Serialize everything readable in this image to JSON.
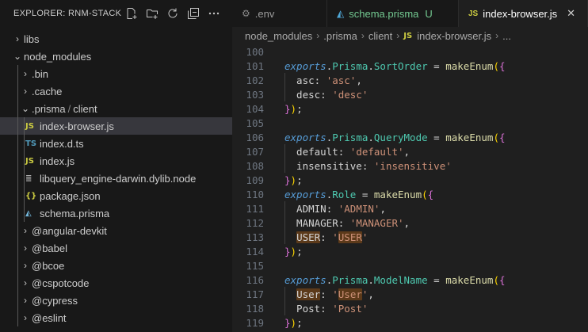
{
  "explorer": {
    "title": "EXPLORER: RNM-STACK",
    "tree": [
      {
        "label": "libs",
        "chevron": "›",
        "icon": "",
        "icon_color": "",
        "label_color": "#cccccc"
      },
      {
        "label": "node_modules",
        "chevron": "⌄",
        "icon": "",
        "icon_color": "",
        "label_color": "#cccccc"
      },
      {
        "label": ".bin",
        "chevron": "›",
        "icon": "",
        "icon_color": "",
        "label_color": "#cccccc"
      },
      {
        "label": ".cache",
        "chevron": "›",
        "icon": "",
        "icon_color": "",
        "label_color": "#cccccc"
      },
      {
        "label": ".prisma",
        "label2": "client",
        "chevron": "⌄",
        "icon": "",
        "icon_color": "",
        "label_color": "#cccccc"
      },
      {
        "label": "index-browser.js",
        "chevron": "",
        "icon": "JS",
        "icon_color": "#cbcb41",
        "label_color": "#cccccc"
      },
      {
        "label": "index.d.ts",
        "chevron": "",
        "icon": "TS",
        "icon_color": "#519aba",
        "label_color": "#cccccc"
      },
      {
        "label": "index.js",
        "chevron": "",
        "icon": "JS",
        "icon_color": "#cbcb41",
        "label_color": "#cccccc"
      },
      {
        "label": "libquery_engine-darwin.dylib.node",
        "chevron": "",
        "icon": "≣",
        "icon_color": "#aaaaaa",
        "label_color": "#cccccc"
      },
      {
        "label": "package.json",
        "chevron": "",
        "icon": "{}",
        "icon_color": "#cbcb41",
        "label_color": "#cccccc"
      },
      {
        "label": "schema.prisma",
        "chevron": "",
        "icon": "◭",
        "icon_color": "#75bbe0",
        "label_color": "#cccccc"
      },
      {
        "label": "@angular-devkit",
        "chevron": "›",
        "icon": "",
        "icon_color": "",
        "label_color": "#cccccc"
      },
      {
        "label": "@babel",
        "chevron": "›",
        "icon": "",
        "icon_color": "",
        "label_color": "#cccccc"
      },
      {
        "label": "@bcoe",
        "chevron": "›",
        "icon": "",
        "icon_color": "",
        "label_color": "#cccccc"
      },
      {
        "label": "@cspotcode",
        "chevron": "›",
        "icon": "",
        "icon_color": "",
        "label_color": "#cccccc"
      },
      {
        "label": "@cypress",
        "chevron": "›",
        "icon": "",
        "icon_color": "",
        "label_color": "#cccccc"
      },
      {
        "label": "@eslint",
        "chevron": "›",
        "icon": "",
        "icon_color": "",
        "label_color": "#cccccc"
      }
    ]
  },
  "tabs": [
    {
      "label": ".env",
      "icon": "gear-icon",
      "badge": "",
      "active": false,
      "color": "#cccccc"
    },
    {
      "label": "schema.prisma",
      "icon": "prisma-icon",
      "badge": "U",
      "active": false,
      "color": "#73c991"
    },
    {
      "label": "index-browser.js",
      "icon": "js-icon",
      "badge": "",
      "active": true,
      "color": "#ffffff"
    }
  ],
  "tab_close": "✕",
  "breadcrumb": [
    "node_modules",
    ".prisma",
    "client",
    "index-browser.js",
    "..."
  ],
  "editor": {
    "lines": [
      {
        "n": "100",
        "tokens": []
      },
      {
        "n": "101",
        "tokens": [
          [
            "exports",
            "kw-exports"
          ],
          [
            ".",
            "c-white"
          ],
          [
            "Prisma",
            "c-ident"
          ],
          [
            ".",
            "c-white"
          ],
          [
            "SortOrder",
            "c-ident"
          ],
          [
            " = ",
            "c-white"
          ],
          [
            "makeEnum",
            "c-fn"
          ],
          [
            "(",
            "c-brace"
          ],
          [
            "{",
            "c-paren"
          ]
        ]
      },
      {
        "n": "102",
        "indent": true,
        "tokens": [
          [
            "  asc",
            "c-white"
          ],
          [
            ": ",
            "c-white"
          ],
          [
            "'asc'",
            "c-str"
          ],
          [
            ",",
            "c-white"
          ]
        ]
      },
      {
        "n": "103",
        "indent": true,
        "tokens": [
          [
            "  desc",
            "c-white"
          ],
          [
            ": ",
            "c-white"
          ],
          [
            "'desc'",
            "c-str"
          ]
        ]
      },
      {
        "n": "104",
        "tokens": [
          [
            "}",
            "c-paren"
          ],
          [
            ")",
            "c-brace"
          ],
          [
            ";",
            "c-white"
          ]
        ]
      },
      {
        "n": "105",
        "tokens": []
      },
      {
        "n": "106",
        "tokens": [
          [
            "exports",
            "kw-exports"
          ],
          [
            ".",
            "c-white"
          ],
          [
            "Prisma",
            "c-ident"
          ],
          [
            ".",
            "c-white"
          ],
          [
            "QueryMode",
            "c-ident"
          ],
          [
            " = ",
            "c-white"
          ],
          [
            "makeEnum",
            "c-fn"
          ],
          [
            "(",
            "c-brace"
          ],
          [
            "{",
            "c-paren"
          ]
        ]
      },
      {
        "n": "107",
        "indent": true,
        "tokens": [
          [
            "  default",
            "c-white"
          ],
          [
            ": ",
            "c-white"
          ],
          [
            "'default'",
            "c-str"
          ],
          [
            ",",
            "c-white"
          ]
        ]
      },
      {
        "n": "108",
        "indent": true,
        "tokens": [
          [
            "  insensitive",
            "c-white"
          ],
          [
            ": ",
            "c-white"
          ],
          [
            "'insensitive'",
            "c-str"
          ]
        ]
      },
      {
        "n": "109",
        "tokens": [
          [
            "}",
            "c-paren"
          ],
          [
            ")",
            "c-brace"
          ],
          [
            ";",
            "c-white"
          ]
        ]
      },
      {
        "n": "110",
        "tokens": [
          [
            "exports",
            "kw-exports"
          ],
          [
            ".",
            "c-white"
          ],
          [
            "Role",
            "c-ident"
          ],
          [
            " = ",
            "c-white"
          ],
          [
            "makeEnum",
            "c-fn"
          ],
          [
            "(",
            "c-brace"
          ],
          [
            "{",
            "c-paren"
          ]
        ]
      },
      {
        "n": "111",
        "indent": true,
        "tokens": [
          [
            "  ADMIN",
            "c-white"
          ],
          [
            ": ",
            "c-white"
          ],
          [
            "'ADMIN'",
            "c-str"
          ],
          [
            ",",
            "c-white"
          ]
        ]
      },
      {
        "n": "112",
        "indent": true,
        "tokens": [
          [
            "  MANAGER",
            "c-white"
          ],
          [
            ": ",
            "c-white"
          ],
          [
            "'MANAGER'",
            "c-str"
          ],
          [
            ",",
            "c-white"
          ]
        ]
      },
      {
        "n": "113",
        "indent": true,
        "tokens": [
          [
            "  ",
            "c-white"
          ],
          [
            "USER",
            "c-white hl"
          ],
          [
            ": ",
            "c-white"
          ],
          [
            "'",
            "c-str"
          ],
          [
            "USER",
            "c-str hl"
          ],
          [
            "'",
            "c-str"
          ]
        ]
      },
      {
        "n": "114",
        "tokens": [
          [
            "}",
            "c-paren"
          ],
          [
            ")",
            "c-brace"
          ],
          [
            ";",
            "c-white"
          ]
        ]
      },
      {
        "n": "115",
        "tokens": []
      },
      {
        "n": "116",
        "tokens": [
          [
            "exports",
            "kw-exports"
          ],
          [
            ".",
            "c-white"
          ],
          [
            "Prisma",
            "c-ident"
          ],
          [
            ".",
            "c-white"
          ],
          [
            "ModelName",
            "c-ident"
          ],
          [
            " = ",
            "c-white"
          ],
          [
            "makeEnum",
            "c-fn"
          ],
          [
            "(",
            "c-brace"
          ],
          [
            "{",
            "c-paren"
          ]
        ]
      },
      {
        "n": "117",
        "indent": true,
        "tokens": [
          [
            "  ",
            "c-white"
          ],
          [
            "User",
            "c-white hl"
          ],
          [
            ": ",
            "c-white"
          ],
          [
            "'",
            "c-str"
          ],
          [
            "User",
            "c-str hl"
          ],
          [
            "'",
            "c-str"
          ],
          [
            ",",
            "c-white"
          ]
        ]
      },
      {
        "n": "118",
        "indent": true,
        "tokens": [
          [
            "  Post",
            "c-white"
          ],
          [
            ": ",
            "c-white"
          ],
          [
            "'Post'",
            "c-str"
          ]
        ]
      },
      {
        "n": "119",
        "tokens": [
          [
            "}",
            "c-paren"
          ],
          [
            ")",
            "c-brace"
          ],
          [
            ";",
            "c-white"
          ]
        ]
      }
    ]
  }
}
